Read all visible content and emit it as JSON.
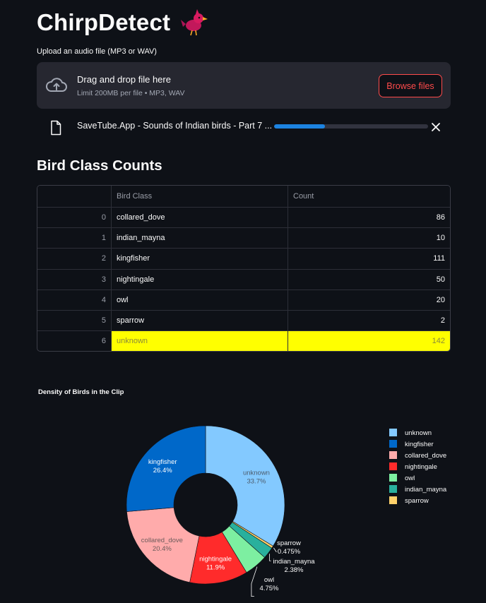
{
  "app": {
    "title": "ChirpDetect"
  },
  "uploader": {
    "label": "Upload an audio file (MP3 or WAV)",
    "drop_text": "Drag and drop file here",
    "limit_text": "Limit 200MB per file • MP3, WAV",
    "browse_label": "Browse files"
  },
  "file": {
    "name": "SaveTube.App - Sounds of Indian birds - Part 7 ...",
    "progress": 0.33
  },
  "table_section": {
    "title": "Bird Class Counts",
    "columns": [
      "",
      "Bird Class",
      "Count"
    ],
    "rows": [
      {
        "index": "0",
        "bird_class": "collared_dove",
        "count": "86"
      },
      {
        "index": "1",
        "bird_class": "indian_mayna",
        "count": "10"
      },
      {
        "index": "2",
        "bird_class": "kingfisher",
        "count": "111"
      },
      {
        "index": "3",
        "bird_class": "nightingale",
        "count": "50"
      },
      {
        "index": "4",
        "bird_class": "owl",
        "count": "20"
      },
      {
        "index": "5",
        "bird_class": "sparrow",
        "count": "2"
      },
      {
        "index": "6",
        "bird_class": "unknown",
        "count": "142"
      }
    ],
    "highlight_color": "#ffff00"
  },
  "chart_data": {
    "type": "pie",
    "title": "Density of Birds in the Clip",
    "hole": true,
    "legend_position": "right",
    "slices": [
      {
        "label": "unknown",
        "value": 142,
        "percent": "33.7%",
        "color": "#83c9ff"
      },
      {
        "label": "sparrow",
        "value": 2,
        "percent": "0.475%",
        "color": "#ffd16a"
      },
      {
        "label": "indian_mayna",
        "value": 10,
        "percent": "2.38%",
        "color": "#29b09d"
      },
      {
        "label": "owl",
        "value": 20,
        "percent": "4.75%",
        "color": "#7defa1"
      },
      {
        "label": "nightingale",
        "value": 50,
        "percent": "11.9%",
        "color": "#ff2b2b"
      },
      {
        "label": "collared_dove",
        "value": 86,
        "percent": "20.4%",
        "color": "#ffabab"
      },
      {
        "label": "kingfisher",
        "value": 111,
        "percent": "26.4%",
        "color": "#0068c9"
      }
    ],
    "legend": [
      "unknown",
      "kingfisher",
      "collared_dove",
      "nightingale",
      "owl",
      "indian_mayna",
      "sparrow"
    ]
  },
  "colors": {
    "background": "#0e1117",
    "panel": "#262730",
    "accent": "#ff4b4b",
    "progress": "#1c83e1"
  }
}
